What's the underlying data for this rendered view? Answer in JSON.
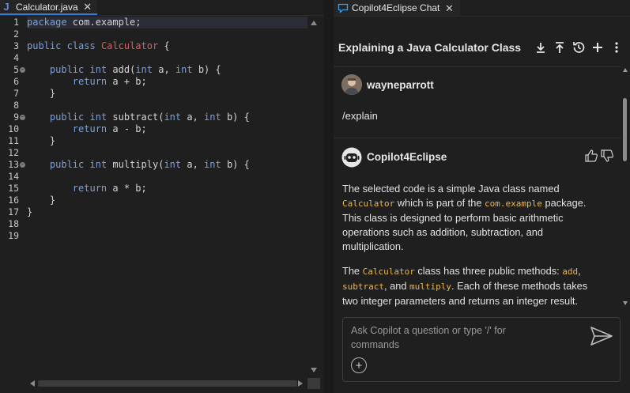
{
  "editor": {
    "tab_title": "Calculator.java",
    "java_icon": "J",
    "close_glyph": "✕",
    "line_numbers": [
      "1",
      "2",
      "3",
      "4",
      "5",
      "6",
      "7",
      "8",
      "9",
      "10",
      "11",
      "12",
      "13",
      "14",
      "15",
      "16",
      "17",
      "18",
      "19"
    ],
    "lines": [
      [
        {
          "t": "package",
          "c": "kw"
        },
        {
          "t": " com.example;",
          "c": "op"
        }
      ],
      [],
      [
        {
          "t": "public",
          "c": "kw"
        },
        {
          "t": " ",
          "c": "op"
        },
        {
          "t": "class",
          "c": "kw"
        },
        {
          "t": " ",
          "c": "op"
        },
        {
          "t": "Calculator",
          "c": "cls"
        },
        {
          "t": " {",
          "c": "op"
        }
      ],
      [],
      [
        {
          "t": "    ",
          "c": "op"
        },
        {
          "t": "public",
          "c": "kw"
        },
        {
          "t": " ",
          "c": "op"
        },
        {
          "t": "int",
          "c": "kw"
        },
        {
          "t": " add(",
          "c": "op"
        },
        {
          "t": "int",
          "c": "kw"
        },
        {
          "t": " a, ",
          "c": "op"
        },
        {
          "t": "int",
          "c": "kw"
        },
        {
          "t": " b) {",
          "c": "op"
        }
      ],
      [
        {
          "t": "        ",
          "c": "op"
        },
        {
          "t": "return",
          "c": "kw"
        },
        {
          "t": " a + b;",
          "c": "op"
        }
      ],
      [
        {
          "t": "    }",
          "c": "op"
        }
      ],
      [],
      [
        {
          "t": "    ",
          "c": "op"
        },
        {
          "t": "public",
          "c": "kw"
        },
        {
          "t": " ",
          "c": "op"
        },
        {
          "t": "int",
          "c": "kw"
        },
        {
          "t": " subtract(",
          "c": "op"
        },
        {
          "t": "int",
          "c": "kw"
        },
        {
          "t": " a, ",
          "c": "op"
        },
        {
          "t": "int",
          "c": "kw"
        },
        {
          "t": " b) {",
          "c": "op"
        }
      ],
      [
        {
          "t": "        ",
          "c": "op"
        },
        {
          "t": "return",
          "c": "kw"
        },
        {
          "t": " a - b;",
          "c": "op"
        }
      ],
      [
        {
          "t": "    }",
          "c": "op"
        }
      ],
      [],
      [
        {
          "t": "    ",
          "c": "op"
        },
        {
          "t": "public",
          "c": "kw"
        },
        {
          "t": " ",
          "c": "op"
        },
        {
          "t": "int",
          "c": "kw"
        },
        {
          "t": " multiply(",
          "c": "op"
        },
        {
          "t": "int",
          "c": "kw"
        },
        {
          "t": " a, ",
          "c": "op"
        },
        {
          "t": "int",
          "c": "kw"
        },
        {
          "t": " b) {",
          "c": "op"
        }
      ],
      [],
      [
        {
          "t": "        ",
          "c": "op"
        },
        {
          "t": "return",
          "c": "kw"
        },
        {
          "t": " a * b;",
          "c": "op"
        }
      ],
      [
        {
          "t": "    }",
          "c": "op"
        }
      ],
      [
        {
          "t": "}",
          "c": "op"
        }
      ],
      [],
      []
    ],
    "fold_markers": [
      5,
      9,
      13
    ],
    "current_line": 1,
    "colors": {
      "keyword": "#7ca0d9",
      "class_name": "#e05a5a",
      "text": "#d4d4d4",
      "background": "#1f1f1f"
    }
  },
  "chat": {
    "tab_title": "Copilot4Eclipse Chat",
    "tab_icon": "chat-bubble-icon",
    "close_glyph": "✕",
    "conversation_title": "Explaining a Java Calculator Class",
    "header_icons": [
      "download-icon",
      "export-icon",
      "history-icon",
      "plus-icon",
      "more-vertical-icon"
    ],
    "user": {
      "name": "wayneparrott",
      "message": "/explain"
    },
    "assistant": {
      "name": "Copilot4Eclipse",
      "paragraphs": [
        [
          {
            "t": "The selected code is a simple Java class named "
          },
          {
            "t": "Calculator",
            "code": true
          },
          {
            "t": " which is part of the "
          },
          {
            "t": "com.example",
            "code": true
          },
          {
            "t": " package. This class is designed to perform basic arithmetic operations such as addition, subtraction, and multiplication."
          }
        ],
        [
          {
            "t": "The "
          },
          {
            "t": "Calculator",
            "code": true
          },
          {
            "t": " class has three public methods: "
          },
          {
            "t": "add",
            "code": true
          },
          {
            "t": ", "
          },
          {
            "t": "subtract",
            "code": true
          },
          {
            "t": ", and "
          },
          {
            "t": "multiply",
            "code": true
          },
          {
            "t": ". Each of these methods takes two integer parameters and returns an integer result."
          }
        ]
      ]
    },
    "input": {
      "placeholder": "Ask Copilot a question or type '/' for commands",
      "plus_glyph": "+"
    },
    "colors": {
      "code_inline": "#e8b657",
      "text": "#e2e2e2",
      "accent": "#3c7bd4"
    }
  }
}
